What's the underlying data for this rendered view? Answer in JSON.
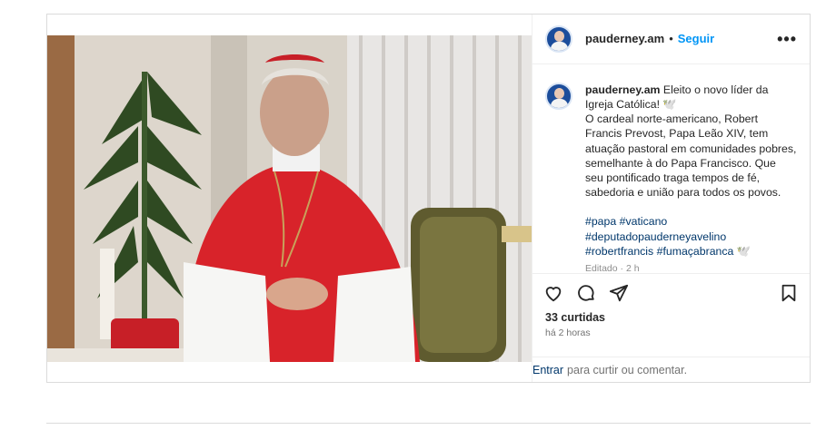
{
  "post": {
    "username": "pauderney.am",
    "separator": "•",
    "follow_label": "Seguir",
    "more_label": "•••",
    "caption": {
      "username": "pauderney.am",
      "line1": "Eleito o novo líder da Igreja Católica! 🕊️",
      "line2": "O cardeal norte-americano, Robert Francis Prevost, Papa Leão XIV, tem atuação pastoral em comunidades pobres, semelhante à do Papa Francisco. Que seu pontificado traga tempos de fé, sabedoria e união para todos os povos.",
      "hashtags": [
        "#papa",
        "#vaticano",
        "#deputadopauderneyavelino",
        "#robertfrancis",
        "#fumaçabranca"
      ],
      "hashtag_suffix": "🕊️",
      "edited": "Editado · 2 h"
    },
    "likes": "33 curtidas",
    "time_ago": "há 2 horas",
    "add_comment": {
      "login_label": "Entrar",
      "rest": "para curtir ou comentar."
    }
  },
  "icons": [
    "heart-icon",
    "comment-icon",
    "share-icon",
    "bookmark-icon",
    "more-icon"
  ],
  "colors": {
    "link": "#0095f6",
    "hashtag": "#00376b",
    "cassock_red": "#d8232a"
  }
}
